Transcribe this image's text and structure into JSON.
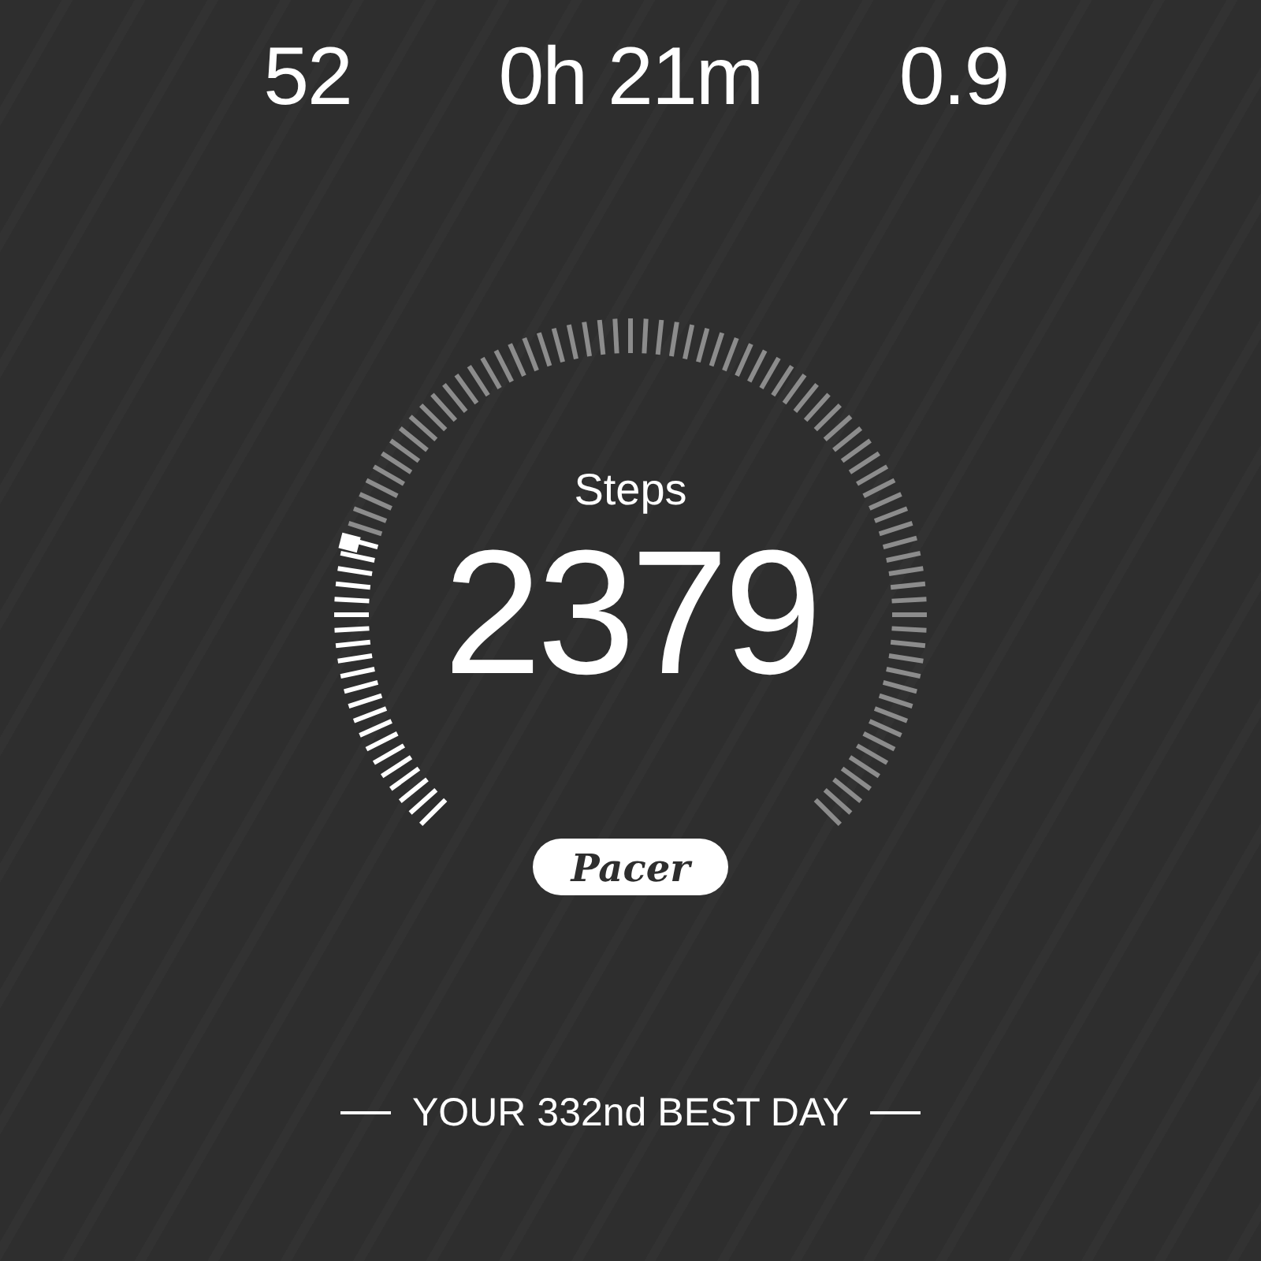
{
  "stats": [
    {
      "value": "52"
    },
    {
      "value": "0h 21m"
    },
    {
      "value": "0.9"
    }
  ],
  "steps": {
    "label": "Steps",
    "value": "2379"
  },
  "logo": {
    "text": "Pacer"
  },
  "footer": {
    "text": "YOUR 332nd BEST DAY"
  }
}
